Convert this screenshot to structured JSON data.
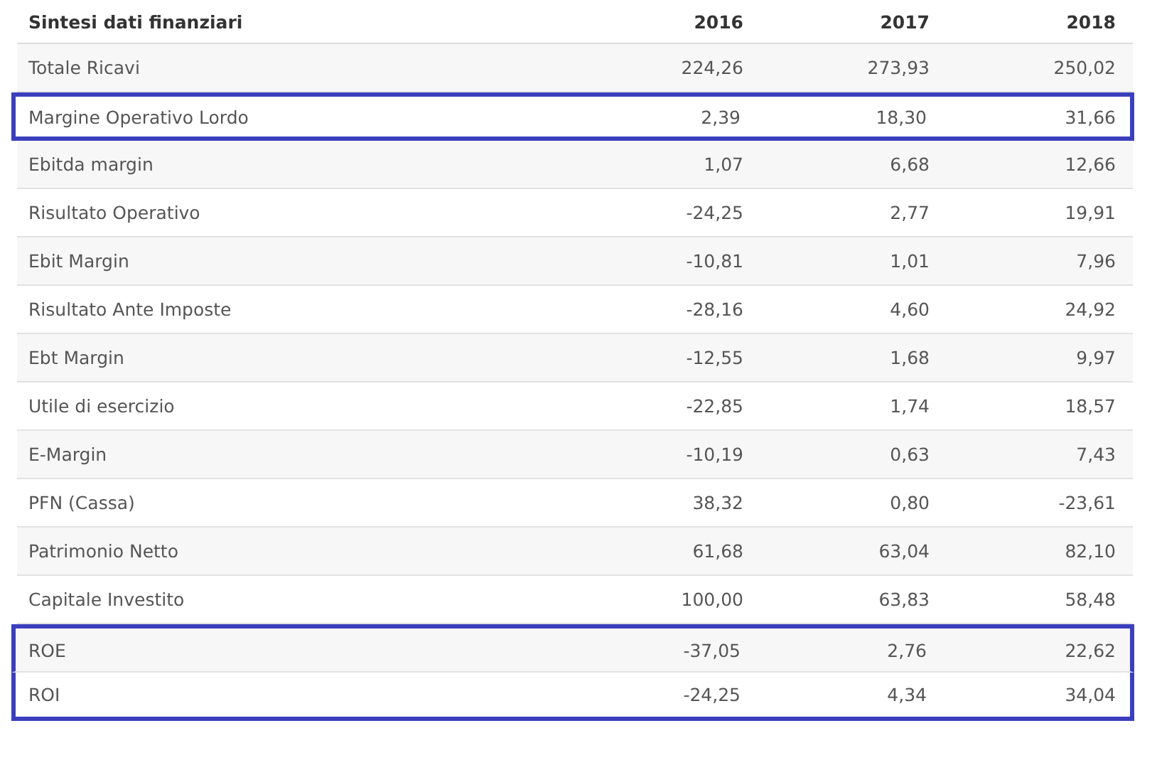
{
  "table": {
    "columns": [
      "Sintesi dati finanziari",
      "2016",
      "2017",
      "2018"
    ],
    "rows": [
      {
        "label": "Totale Ricavi",
        "values": [
          "224,26",
          "273,93",
          "250,02"
        ],
        "highlighted": false
      },
      {
        "label": "Margine Operativo Lordo",
        "values": [
          "2,39",
          "18,30",
          "31,66"
        ],
        "highlighted": true
      },
      {
        "label": "Ebitda margin",
        "values": [
          "1,07",
          "6,68",
          "12,66"
        ],
        "highlighted": false
      },
      {
        "label": "Risultato Operativo",
        "values": [
          "-24,25",
          "2,77",
          "19,91"
        ],
        "highlighted": false
      },
      {
        "label": "Ebit Margin",
        "values": [
          "-10,81",
          "1,01",
          "7,96"
        ],
        "highlighted": false
      },
      {
        "label": "Risultato Ante Imposte",
        "values": [
          "-28,16",
          "4,60",
          "24,92"
        ],
        "highlighted": false
      },
      {
        "label": "Ebt Margin",
        "values": [
          "-12,55",
          "1,68",
          "9,97"
        ],
        "highlighted": false
      },
      {
        "label": "Utile di esercizio",
        "values": [
          "-22,85",
          "1,74",
          "18,57"
        ],
        "highlighted": false
      },
      {
        "label": "E-Margin",
        "values": [
          "-10,19",
          "0,63",
          "7,43"
        ],
        "highlighted": false
      },
      {
        "label": "PFN (Cassa)",
        "values": [
          "38,32",
          "0,80",
          "-23,61"
        ],
        "highlighted": false
      },
      {
        "label": "Patrimonio Netto",
        "values": [
          "61,68",
          "63,04",
          "82,10"
        ],
        "highlighted": false
      },
      {
        "label": "Capitale Investito",
        "values": [
          "100,00",
          "63,83",
          "58,48"
        ],
        "highlighted": false
      },
      {
        "label": "ROE",
        "values": [
          "-37,05",
          "2,76",
          "22,62"
        ],
        "highlighted": true
      },
      {
        "label": "ROI",
        "values": [
          "-24,25",
          "4,34",
          "34,04"
        ],
        "highlighted": true
      }
    ]
  }
}
